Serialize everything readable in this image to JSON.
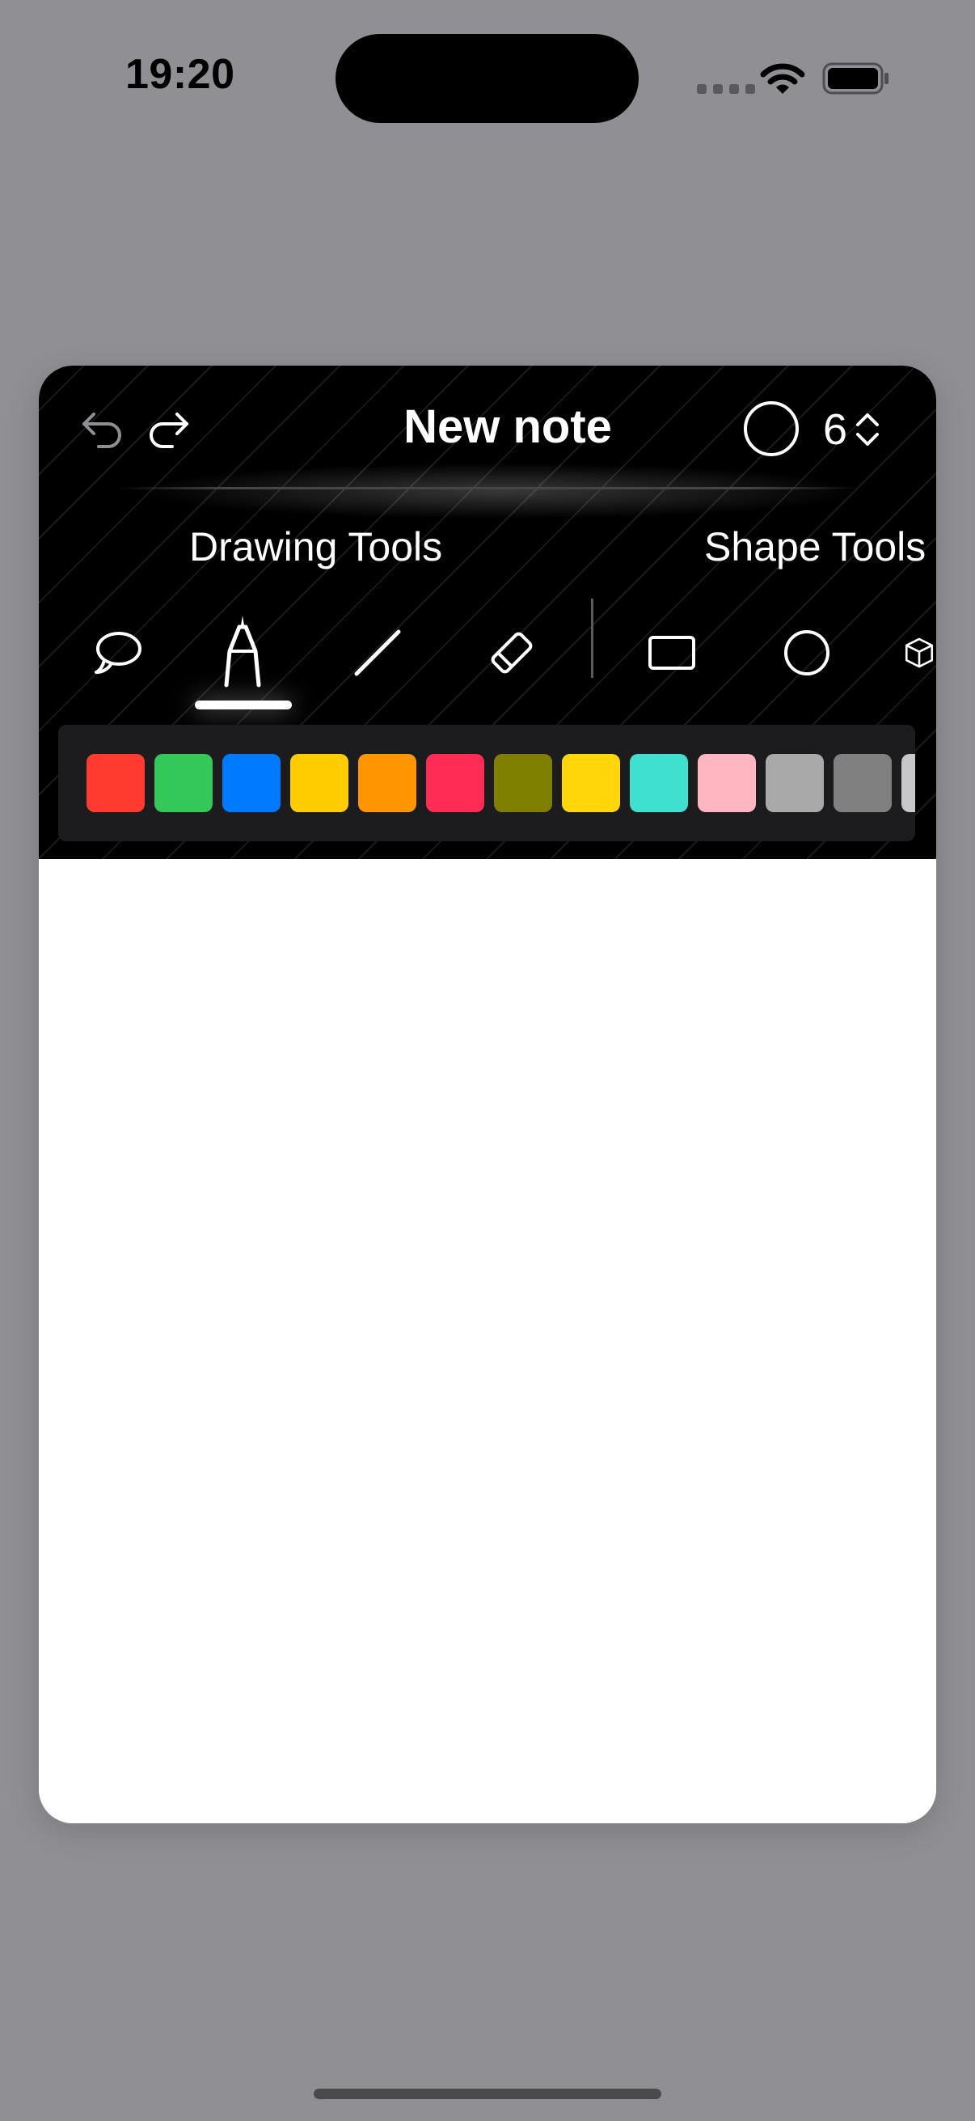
{
  "status_bar": {
    "time": "19:20"
  },
  "header": {
    "title": "New note",
    "stroke_size": "6"
  },
  "sections": {
    "drawing": "Drawing Tools",
    "shape": "Shape Tools"
  },
  "tools": {
    "drawing": [
      "lasso-icon",
      "pen-icon",
      "line-icon",
      "eraser-icon"
    ],
    "shape": [
      "rectangle-icon",
      "circle-icon",
      "cube-icon"
    ],
    "selected": "pen-icon"
  },
  "palette": {
    "colors": [
      "#FF3B30",
      "#34C759",
      "#007AFF",
      "#FFCC00",
      "#FF9500",
      "#FF2D55",
      "#808000",
      "#FFD60A",
      "#40E0D0",
      "#FFB6C1",
      "#A9A9A9",
      "#808080",
      "#C8C8C8"
    ]
  },
  "theme": {
    "toolbar_bg": "#000000",
    "canvas_bg": "#FFFFFF",
    "page_bg": "#8F8F94"
  }
}
